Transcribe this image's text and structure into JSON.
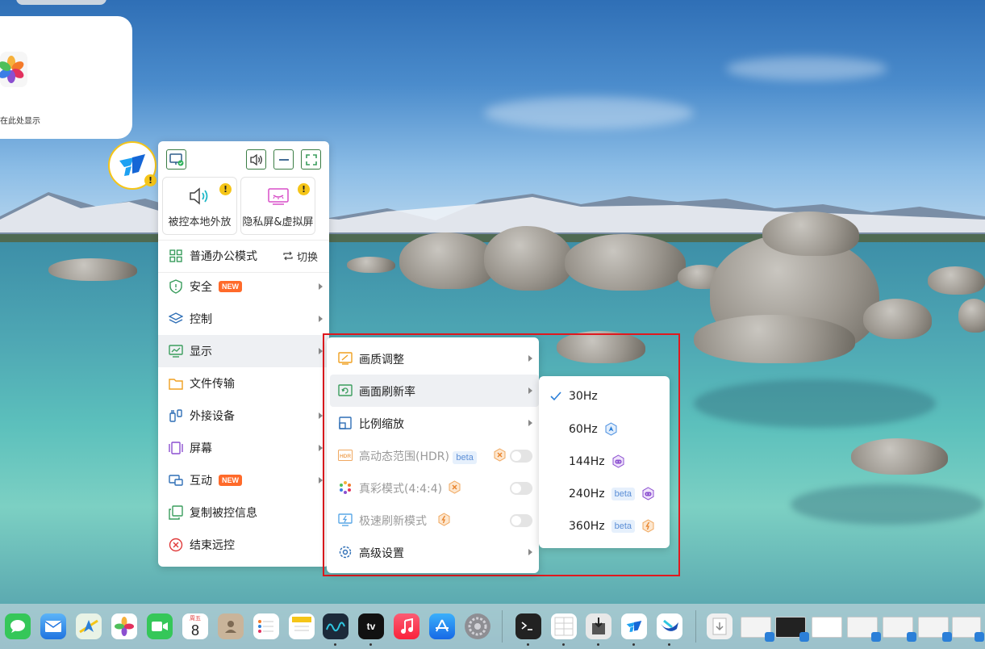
{
  "photos_widget": {
    "caption": "片将在此处显示"
  },
  "main_panel": {
    "cards": [
      {
        "label": "被控本地外放",
        "warning": "!"
      },
      {
        "label": "隐私屏&虚拟屏",
        "warning": "!"
      }
    ],
    "mode": {
      "label": "普通办公模式",
      "switch_label": "切换"
    },
    "items": [
      {
        "label": "安全",
        "badge": "NEW"
      },
      {
        "label": "控制"
      },
      {
        "label": "显示"
      },
      {
        "label": "文件传输"
      },
      {
        "label": "外接设备"
      },
      {
        "label": "屏幕"
      },
      {
        "label": "互动",
        "badge": "NEW"
      },
      {
        "label": "复制被控信息"
      },
      {
        "label": "结束远控"
      }
    ]
  },
  "display_submenu": {
    "items": [
      {
        "label": "画质调整"
      },
      {
        "label": "画面刷新率"
      },
      {
        "label": "比例缩放"
      },
      {
        "label": "高动态范围(HDR)",
        "tag": "beta"
      },
      {
        "label": "真彩模式(4:4:4)"
      },
      {
        "label": "极速刷新模式"
      },
      {
        "label": "高级设置"
      }
    ]
  },
  "refresh_rate_submenu": {
    "selected": "30Hz",
    "items": [
      {
        "label": "30Hz"
      },
      {
        "label": "60Hz"
      },
      {
        "label": "144Hz"
      },
      {
        "label": "240Hz",
        "tag": "beta"
      },
      {
        "label": "360Hz",
        "tag": "beta"
      }
    ]
  },
  "dock": {
    "calendar": {
      "weekday": "周五",
      "day": "8"
    },
    "tv_label": "tv"
  },
  "colors": {
    "highlight_border": "#e0191e",
    "accent_green": "#3a9d5d",
    "badge_new": "#ff6a2a",
    "beta_bg": "#e6f0fc",
    "warning": "#f5c518"
  }
}
